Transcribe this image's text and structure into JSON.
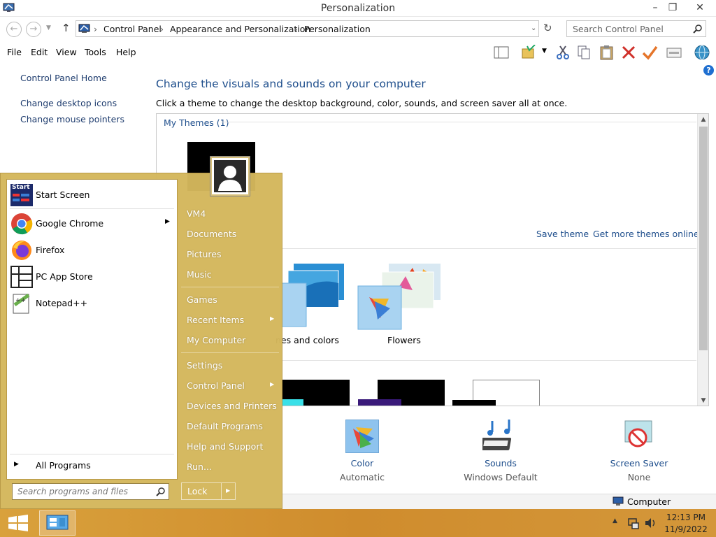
{
  "window": {
    "title": "Personalization",
    "minimize": "–",
    "restore": "❐",
    "close": "✕"
  },
  "nav": {
    "back": "←",
    "forward": "→",
    "up": "↑",
    "breadcrumbs": [
      "Control Panel",
      "Appearance and Personalization",
      "Personalization"
    ],
    "refresh": "↻",
    "search_placeholder": "Search Control Panel"
  },
  "menu": [
    "File",
    "Edit",
    "View",
    "Tools",
    "Help"
  ],
  "left_pane": {
    "home": "Control Panel Home",
    "links": [
      "Change desktop icons",
      "Change mouse pointers"
    ]
  },
  "main": {
    "title": "Change the visuals and sounds on your computer",
    "description": "Click a theme to change the desktop background, color, sounds, and screen saver all at once.",
    "my_themes": "My Themes (1)",
    "save_theme": "Save theme",
    "more_themes": "Get more themes online",
    "themes": [
      {
        "label": "nes and colors"
      },
      {
        "label": "Flowers"
      }
    ]
  },
  "bottom": {
    "items": [
      {
        "title": "Color",
        "sub": "Automatic"
      },
      {
        "title": "Sounds",
        "sub": "Windows Default"
      },
      {
        "title": "Screen Saver",
        "sub": "None"
      }
    ]
  },
  "status": {
    "computer": "Computer"
  },
  "start_menu": {
    "programs": [
      {
        "name": "Start Screen",
        "icon": "start-screen-icon"
      },
      {
        "name": "Google Chrome",
        "icon": "chrome-icon"
      },
      {
        "name": "Firefox",
        "icon": "firefox-icon"
      },
      {
        "name": "PC App Store",
        "icon": "app-store-icon"
      },
      {
        "name": "Notepad++",
        "icon": "notepad-icon"
      }
    ],
    "start_screen_badge": "Start",
    "all_programs": "All Programs",
    "search_placeholder": "Search programs and files",
    "right": [
      "VM4",
      "Documents",
      "Pictures",
      "Music",
      "Games",
      "Recent Items",
      "My Computer",
      "Settings",
      "Control Panel",
      "Devices and Printers",
      "Default Programs",
      "Help and Support",
      "Run..."
    ],
    "lock": "Lock"
  },
  "taskbar": {
    "time": "12:13 PM",
    "date": "11/9/2022"
  },
  "colors": {
    "link": "#1e4e8c",
    "taskbar": "#d4973a",
    "start_menu": "#d4b75c"
  }
}
